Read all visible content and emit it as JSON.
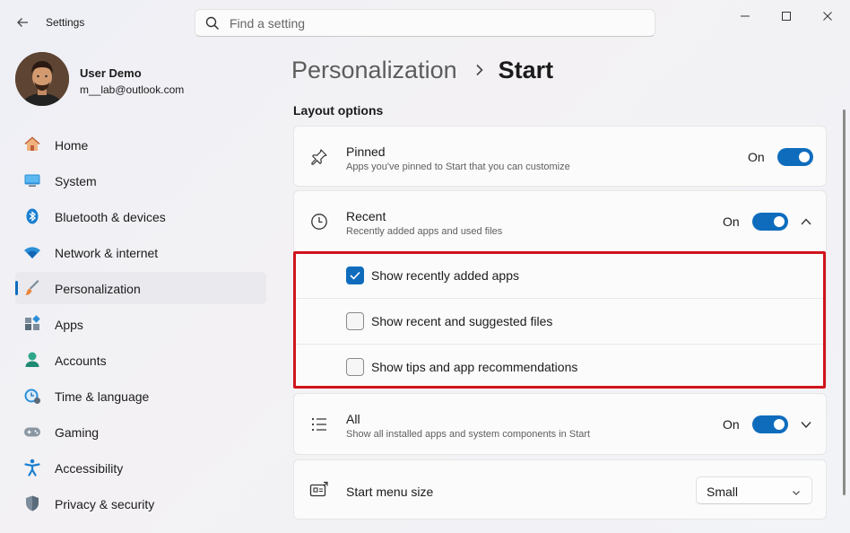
{
  "window": {
    "app_title": "Settings"
  },
  "search": {
    "placeholder": "Find a setting"
  },
  "profile": {
    "name": "User Demo",
    "email": "m__lab@outlook.com"
  },
  "sidebar": {
    "items": [
      {
        "label": "Home",
        "icon": "home-icon"
      },
      {
        "label": "System",
        "icon": "system-icon"
      },
      {
        "label": "Bluetooth & devices",
        "icon": "bluetooth-icon"
      },
      {
        "label": "Network & internet",
        "icon": "wifi-icon"
      },
      {
        "label": "Personalization",
        "icon": "brush-icon",
        "active": true
      },
      {
        "label": "Apps",
        "icon": "apps-icon"
      },
      {
        "label": "Accounts",
        "icon": "accounts-icon"
      },
      {
        "label": "Time & language",
        "icon": "time-language-icon"
      },
      {
        "label": "Gaming",
        "icon": "gamepad-icon"
      },
      {
        "label": "Accessibility",
        "icon": "accessibility-icon"
      },
      {
        "label": "Privacy & security",
        "icon": "shield-icon"
      }
    ]
  },
  "breadcrumb": {
    "parent": "Personalization",
    "current": "Start"
  },
  "main": {
    "section_title": "Layout options",
    "pinned": {
      "title": "Pinned",
      "description": "Apps you've pinned to Start that you can customize",
      "state_label": "On",
      "on": true
    },
    "recent": {
      "title": "Recent",
      "description": "Recently added apps and used files",
      "state_label": "On",
      "on": true,
      "expanded": true,
      "options": [
        {
          "label": "Show recently added apps",
          "checked": true
        },
        {
          "label": "Show recent and suggested files",
          "checked": false
        },
        {
          "label": "Show tips and app recommendations",
          "checked": false
        }
      ]
    },
    "all": {
      "title": "All",
      "description": "Show all installed apps and system components in Start",
      "state_label": "On",
      "on": true
    },
    "menu_size": {
      "title": "Start menu size",
      "value": "Small"
    }
  },
  "colors": {
    "accent": "#0f6cbd",
    "highlight": "#d0141c"
  }
}
